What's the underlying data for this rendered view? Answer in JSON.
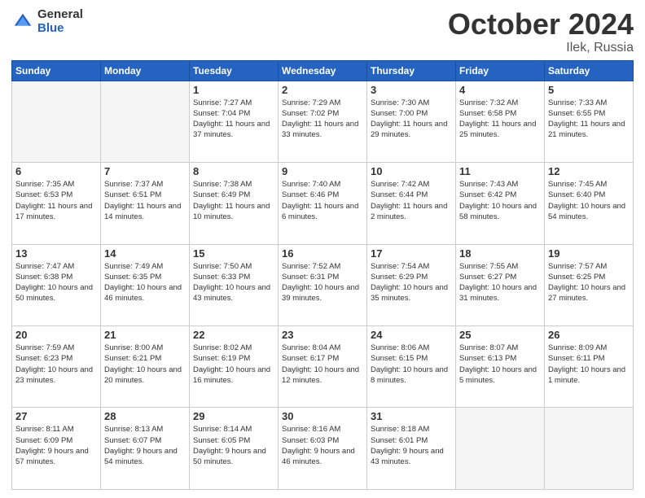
{
  "header": {
    "logo_general": "General",
    "logo_blue": "Blue",
    "month_title": "October 2024",
    "subtitle": "Ilek, Russia"
  },
  "days_of_week": [
    "Sunday",
    "Monday",
    "Tuesday",
    "Wednesday",
    "Thursday",
    "Friday",
    "Saturday"
  ],
  "weeks": [
    [
      {
        "day": "",
        "empty": true
      },
      {
        "day": "",
        "empty": true
      },
      {
        "day": "1",
        "sunrise": "7:27 AM",
        "sunset": "7:04 PM",
        "daylight": "11 hours and 37 minutes."
      },
      {
        "day": "2",
        "sunrise": "7:29 AM",
        "sunset": "7:02 PM",
        "daylight": "11 hours and 33 minutes."
      },
      {
        "day": "3",
        "sunrise": "7:30 AM",
        "sunset": "7:00 PM",
        "daylight": "11 hours and 29 minutes."
      },
      {
        "day": "4",
        "sunrise": "7:32 AM",
        "sunset": "6:58 PM",
        "daylight": "11 hours and 25 minutes."
      },
      {
        "day": "5",
        "sunrise": "7:33 AM",
        "sunset": "6:55 PM",
        "daylight": "11 hours and 21 minutes."
      }
    ],
    [
      {
        "day": "6",
        "sunrise": "7:35 AM",
        "sunset": "6:53 PM",
        "daylight": "11 hours and 17 minutes."
      },
      {
        "day": "7",
        "sunrise": "7:37 AM",
        "sunset": "6:51 PM",
        "daylight": "11 hours and 14 minutes."
      },
      {
        "day": "8",
        "sunrise": "7:38 AM",
        "sunset": "6:49 PM",
        "daylight": "11 hours and 10 minutes."
      },
      {
        "day": "9",
        "sunrise": "7:40 AM",
        "sunset": "6:46 PM",
        "daylight": "11 hours and 6 minutes."
      },
      {
        "day": "10",
        "sunrise": "7:42 AM",
        "sunset": "6:44 PM",
        "daylight": "11 hours and 2 minutes."
      },
      {
        "day": "11",
        "sunrise": "7:43 AM",
        "sunset": "6:42 PM",
        "daylight": "10 hours and 58 minutes."
      },
      {
        "day": "12",
        "sunrise": "7:45 AM",
        "sunset": "6:40 PM",
        "daylight": "10 hours and 54 minutes."
      }
    ],
    [
      {
        "day": "13",
        "sunrise": "7:47 AM",
        "sunset": "6:38 PM",
        "daylight": "10 hours and 50 minutes."
      },
      {
        "day": "14",
        "sunrise": "7:49 AM",
        "sunset": "6:35 PM",
        "daylight": "10 hours and 46 minutes."
      },
      {
        "day": "15",
        "sunrise": "7:50 AM",
        "sunset": "6:33 PM",
        "daylight": "10 hours and 43 minutes."
      },
      {
        "day": "16",
        "sunrise": "7:52 AM",
        "sunset": "6:31 PM",
        "daylight": "10 hours and 39 minutes."
      },
      {
        "day": "17",
        "sunrise": "7:54 AM",
        "sunset": "6:29 PM",
        "daylight": "10 hours and 35 minutes."
      },
      {
        "day": "18",
        "sunrise": "7:55 AM",
        "sunset": "6:27 PM",
        "daylight": "10 hours and 31 minutes."
      },
      {
        "day": "19",
        "sunrise": "7:57 AM",
        "sunset": "6:25 PM",
        "daylight": "10 hours and 27 minutes."
      }
    ],
    [
      {
        "day": "20",
        "sunrise": "7:59 AM",
        "sunset": "6:23 PM",
        "daylight": "10 hours and 23 minutes."
      },
      {
        "day": "21",
        "sunrise": "8:00 AM",
        "sunset": "6:21 PM",
        "daylight": "10 hours and 20 minutes."
      },
      {
        "day": "22",
        "sunrise": "8:02 AM",
        "sunset": "6:19 PM",
        "daylight": "10 hours and 16 minutes."
      },
      {
        "day": "23",
        "sunrise": "8:04 AM",
        "sunset": "6:17 PM",
        "daylight": "10 hours and 12 minutes."
      },
      {
        "day": "24",
        "sunrise": "8:06 AM",
        "sunset": "6:15 PM",
        "daylight": "10 hours and 8 minutes."
      },
      {
        "day": "25",
        "sunrise": "8:07 AM",
        "sunset": "6:13 PM",
        "daylight": "10 hours and 5 minutes."
      },
      {
        "day": "26",
        "sunrise": "8:09 AM",
        "sunset": "6:11 PM",
        "daylight": "10 hours and 1 minute."
      }
    ],
    [
      {
        "day": "27",
        "sunrise": "8:11 AM",
        "sunset": "6:09 PM",
        "daylight": "9 hours and 57 minutes."
      },
      {
        "day": "28",
        "sunrise": "8:13 AM",
        "sunset": "6:07 PM",
        "daylight": "9 hours and 54 minutes."
      },
      {
        "day": "29",
        "sunrise": "8:14 AM",
        "sunset": "6:05 PM",
        "daylight": "9 hours and 50 minutes."
      },
      {
        "day": "30",
        "sunrise": "8:16 AM",
        "sunset": "6:03 PM",
        "daylight": "9 hours and 46 minutes."
      },
      {
        "day": "31",
        "sunrise": "8:18 AM",
        "sunset": "6:01 PM",
        "daylight": "9 hours and 43 minutes."
      },
      {
        "day": "",
        "empty": true
      },
      {
        "day": "",
        "empty": true
      }
    ]
  ]
}
